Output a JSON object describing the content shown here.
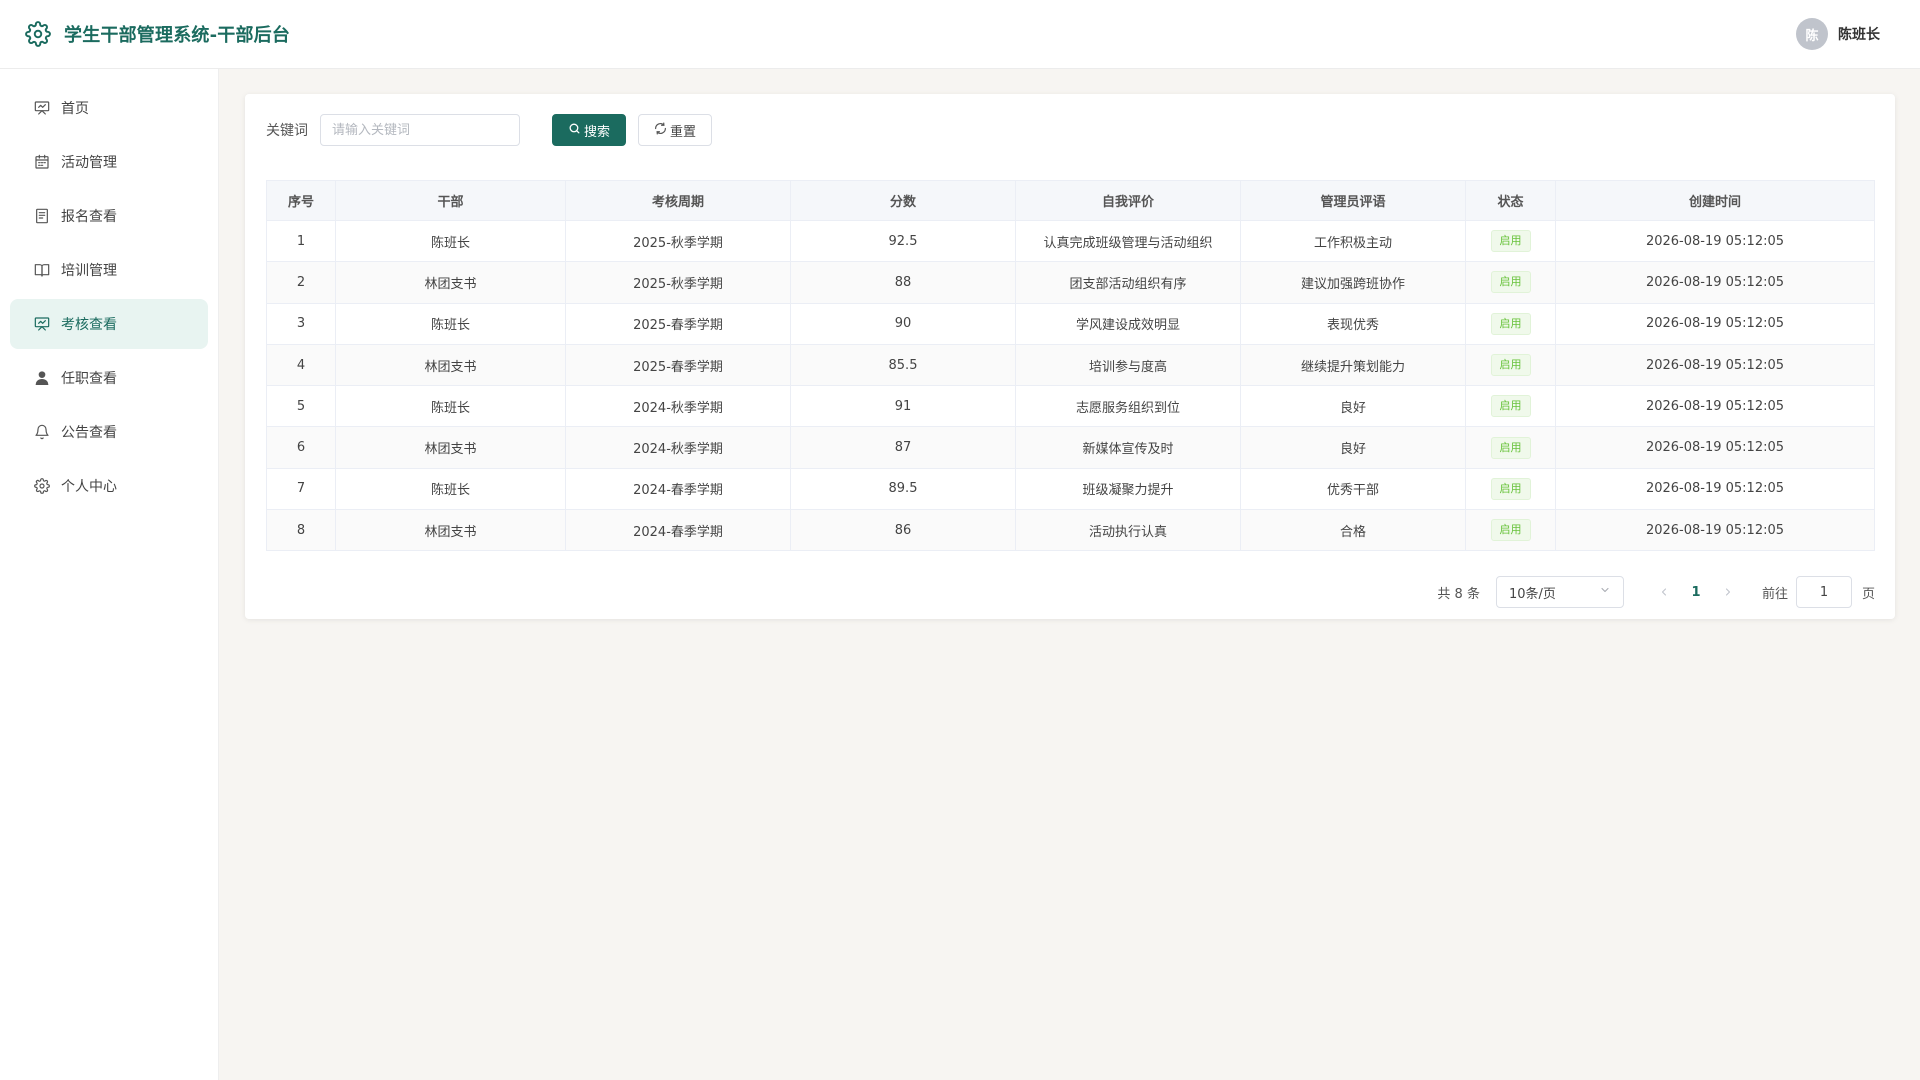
{
  "header": {
    "title": "学生干部管理系统-干部后台",
    "user": {
      "avatar_text": "陈",
      "name": "陈班长"
    }
  },
  "sidebar": {
    "items": [
      {
        "label": "首页",
        "icon": "presentation-icon",
        "active": false
      },
      {
        "label": "活动管理",
        "icon": "calendar-icon",
        "active": false
      },
      {
        "label": "报名查看",
        "icon": "document-icon",
        "active": false
      },
      {
        "label": "培训管理",
        "icon": "book-icon",
        "active": false
      },
      {
        "label": "考核查看",
        "icon": "presentation-icon",
        "active": true
      },
      {
        "label": "任职查看",
        "icon": "user-icon",
        "active": false
      },
      {
        "label": "公告查看",
        "icon": "bell-icon",
        "active": false
      },
      {
        "label": "个人中心",
        "icon": "gear-icon",
        "active": false
      }
    ]
  },
  "search": {
    "label": "关键词",
    "placeholder": "请输入关键词",
    "value": "",
    "search_label": "搜索",
    "reset_label": "重置"
  },
  "table": {
    "columns": [
      "序号",
      "干部",
      "考核周期",
      "分数",
      "自我评价",
      "管理员评语",
      "状态",
      "创建时间"
    ],
    "rows": [
      [
        "1",
        "陈班长",
        "2025-秋季学期",
        "92.5",
        "认真完成班级管理与活动组织",
        "工作积极主动",
        "启用",
        "2026-08-19 05:12:05"
      ],
      [
        "2",
        "林团支书",
        "2025-秋季学期",
        "88",
        "团支部活动组织有序",
        "建议加强跨班协作",
        "启用",
        "2026-08-19 05:12:05"
      ],
      [
        "3",
        "陈班长",
        "2025-春季学期",
        "90",
        "学风建设成效明显",
        "表现优秀",
        "启用",
        "2026-08-19 05:12:05"
      ],
      [
        "4",
        "林团支书",
        "2025-春季学期",
        "85.5",
        "培训参与度高",
        "继续提升策划能力",
        "启用",
        "2026-08-19 05:12:05"
      ],
      [
        "5",
        "陈班长",
        "2024-秋季学期",
        "91",
        "志愿服务组织到位",
        "良好",
        "启用",
        "2026-08-19 05:12:05"
      ],
      [
        "6",
        "林团支书",
        "2024-秋季学期",
        "87",
        "新媒体宣传及时",
        "良好",
        "启用",
        "2026-08-19 05:12:05"
      ],
      [
        "7",
        "陈班长",
        "2024-春季学期",
        "89.5",
        "班级凝聚力提升",
        "优秀干部",
        "启用",
        "2026-08-19 05:12:05"
      ],
      [
        "8",
        "林团支书",
        "2024-春季学期",
        "86",
        "活动执行认真",
        "合格",
        "启用",
        "2026-08-19 05:12:05"
      ]
    ]
  },
  "pagination": {
    "total_text": "共 8 条",
    "page_size": "10条/页",
    "current_page": "1",
    "goto_label": "前往",
    "goto_value": "1",
    "page_unit": "页"
  },
  "colors": {
    "accent": "#1b6b5f",
    "active_bg": "#e8f4f1",
    "tag_green": "#67c23a"
  }
}
